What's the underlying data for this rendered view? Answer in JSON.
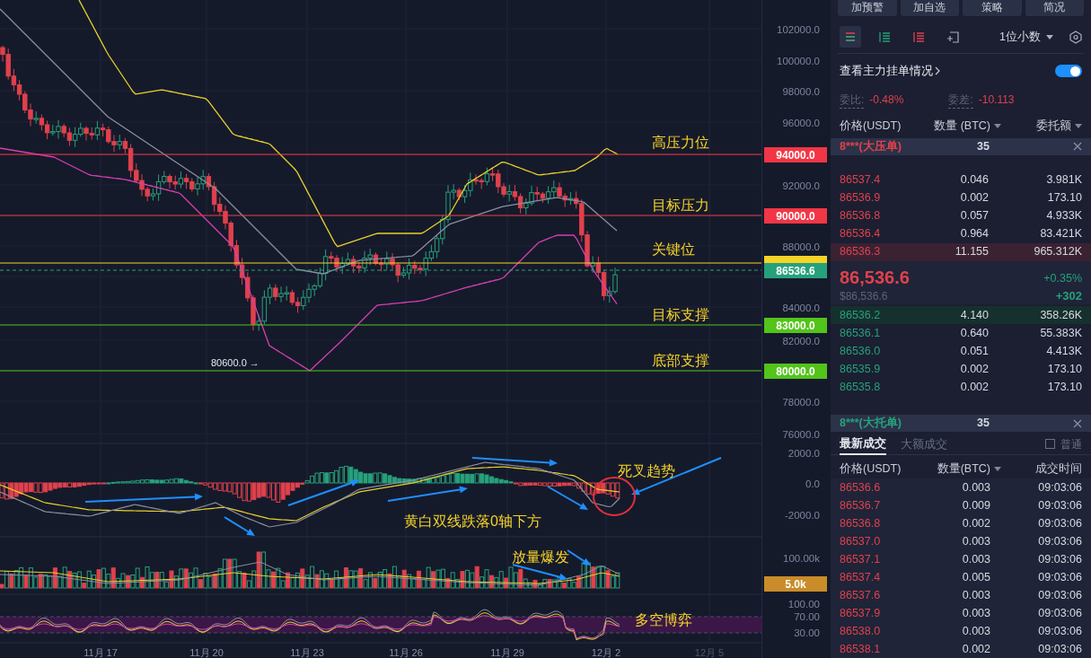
{
  "chart": {
    "levels": [
      {
        "kind": "resistance",
        "label": "94000.0",
        "note": "高压力位",
        "color": "#f23645"
      },
      {
        "kind": "resistance",
        "label": "90000.0",
        "note": "目标压力",
        "color": "#f23645"
      },
      {
        "kind": "key",
        "note": "关键位",
        "color": "#f5d327"
      },
      {
        "kind": "current",
        "label": "86536.6",
        "color": "#26a17b"
      },
      {
        "kind": "support",
        "label": "83000.0",
        "note": "目标支撑",
        "color": "#52c41a"
      },
      {
        "kind": "support",
        "label": "80000.0",
        "note": "底部支撑",
        "color": "#52c41a"
      }
    ],
    "low_marker": "80600.0 →",
    "macd_note": "黄白双线跌落0轴下方",
    "cross_note": "死叉趋势",
    "volume_note": "放量爆发",
    "rsi_note": "多空博弈",
    "axis_ticks": [
      "102000.0",
      "100000.0",
      "98000.0",
      "96000.0",
      "92000.0",
      "88000.0",
      "84000.0",
      "82000.0",
      "78000.0",
      "76000.0",
      "2000.0",
      "0.0",
      "-2000.0",
      "100.00k",
      "100.00",
      "70.00",
      "30.00"
    ],
    "volume_tag": "5.0k",
    "dates": [
      "11月 17",
      "11月 20",
      "11月 23",
      "11月 26",
      "11月 29",
      "12月 2",
      "12月 5"
    ]
  },
  "toolbar_buttons": [
    "加预警",
    "加自选",
    "策略",
    "简况"
  ],
  "order_book": {
    "precision": "1位小数",
    "main_orders": {
      "label": "查看主力挂单情况",
      "on": true
    },
    "ratio_label": "委比:",
    "ratio": "-0.48%",
    "diff_label": "委差:",
    "diff": "-10.113",
    "columns": [
      "价格(USDT)",
      "数量 (BTC)",
      "委托额"
    ],
    "ask_banner": {
      "label": "8***(大压单)",
      "count": "35"
    },
    "asks": [
      {
        "price": "86537.4",
        "qty": "0.046",
        "total": "3.981K",
        "highlighted": false
      },
      {
        "price": "86536.9",
        "qty": "0.002",
        "total": "173.10",
        "highlighted": false
      },
      {
        "price": "86536.8",
        "qty": "0.057",
        "total": "4.933K",
        "highlighted": false
      },
      {
        "price": "86536.4",
        "qty": "0.964",
        "total": "83.421K",
        "highlighted": false
      },
      {
        "price": "86536.3",
        "qty": "11.155",
        "total": "965.312K",
        "highlighted": true
      }
    ],
    "last_price": "86,536.6",
    "last_price_usd": "$86,536.6",
    "change_pct": "+0.35%",
    "change": "+302",
    "bids": [
      {
        "price": "86536.2",
        "qty": "4.140",
        "total": "358.26K",
        "highlighted": true
      },
      {
        "price": "86536.1",
        "qty": "0.640",
        "total": "55.383K",
        "highlighted": false
      },
      {
        "price": "86536.0",
        "qty": "0.051",
        "total": "4.413K",
        "highlighted": false
      },
      {
        "price": "86535.9",
        "qty": "0.002",
        "total": "173.10",
        "highlighted": false
      },
      {
        "price": "86535.8",
        "qty": "0.002",
        "total": "173.10",
        "highlighted": false
      }
    ],
    "bid_banner": {
      "label": "8***(大托单)",
      "count": "35"
    }
  },
  "trades": {
    "tabs": [
      {
        "label": "最新成交",
        "selected": true
      },
      {
        "label": "大额成交",
        "selected": false
      }
    ],
    "filter": {
      "label": "普通",
      "checked": false
    },
    "columns": [
      "价格(USDT)",
      "数量(BTC)",
      "成交时间"
    ],
    "rows": [
      {
        "price": "86536.6",
        "qty": "0.003",
        "time": "09:03:06"
      },
      {
        "price": "86536.7",
        "qty": "0.009",
        "time": "09:03:06"
      },
      {
        "price": "86536.8",
        "qty": "0.002",
        "time": "09:03:06"
      },
      {
        "price": "86537.0",
        "qty": "0.003",
        "time": "09:03:06"
      },
      {
        "price": "86537.1",
        "qty": "0.003",
        "time": "09:03:06"
      },
      {
        "price": "86537.4",
        "qty": "0.005",
        "time": "09:03:06"
      },
      {
        "price": "86537.6",
        "qty": "0.003",
        "time": "09:03:06"
      },
      {
        "price": "86537.9",
        "qty": "0.003",
        "time": "09:03:06"
      },
      {
        "price": "86538.0",
        "qty": "0.003",
        "time": "09:03:06"
      },
      {
        "price": "86538.1",
        "qty": "0.002",
        "time": "09:03:06"
      }
    ]
  }
}
